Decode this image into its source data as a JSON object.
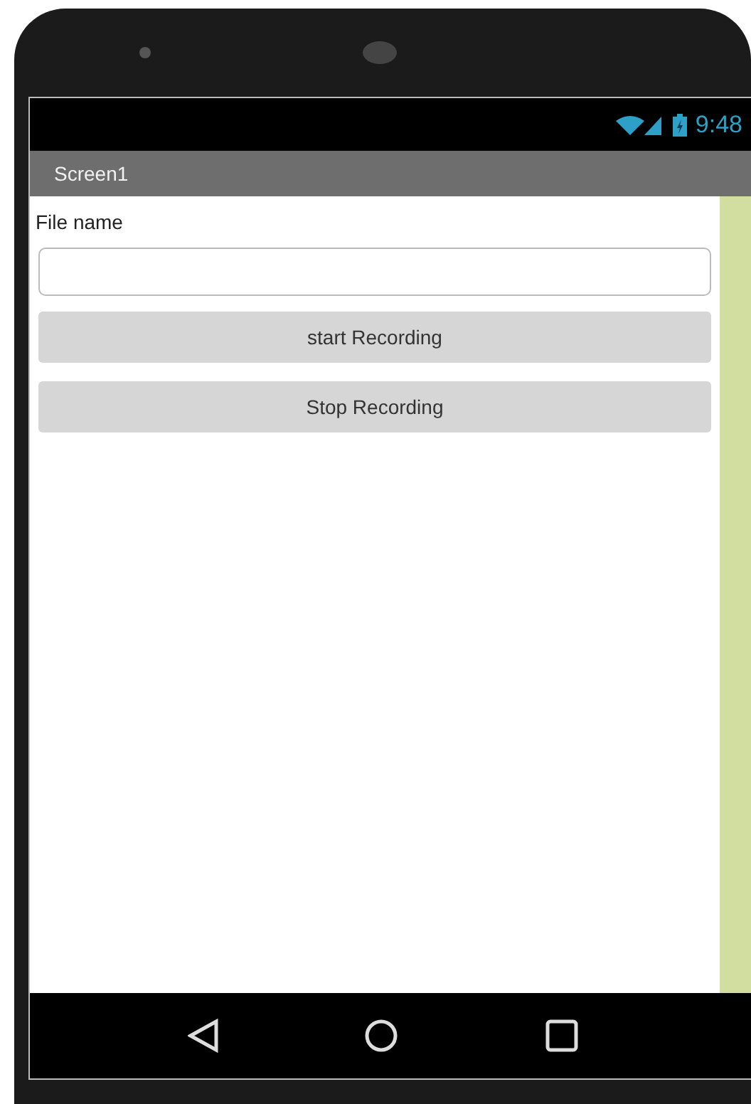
{
  "status_bar": {
    "time": "9:48"
  },
  "title_bar": {
    "title": "Screen1"
  },
  "form": {
    "label": "File name"
  },
  "buttons": [
    {
      "label": "start Recording"
    },
    {
      "label": "Stop Recording"
    }
  ]
}
